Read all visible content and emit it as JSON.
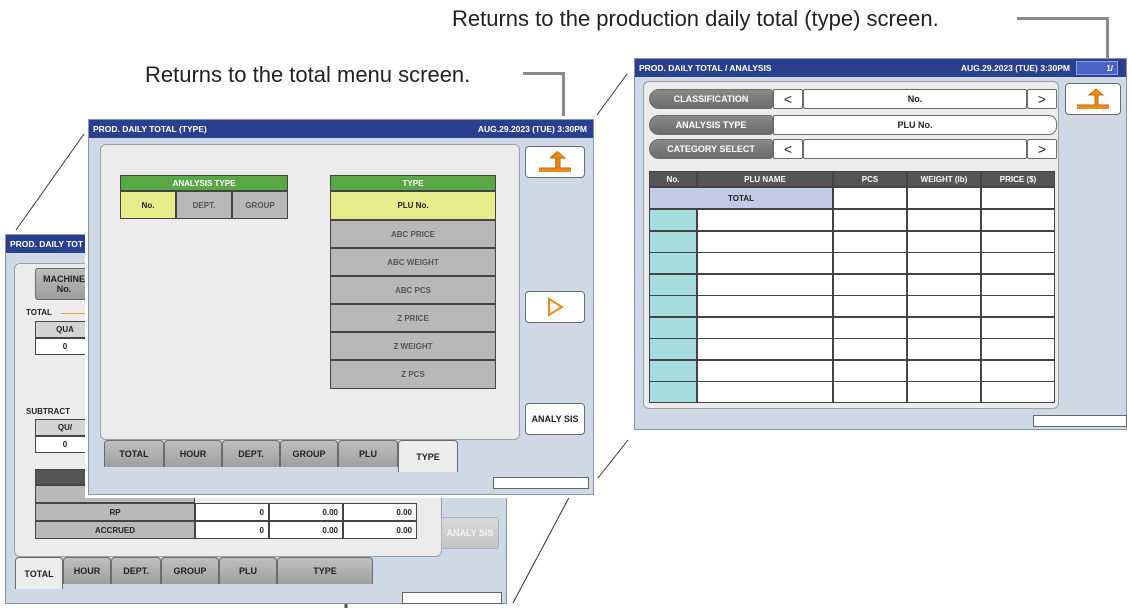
{
  "callouts": {
    "production_type_return": "Returns to the production daily total (type) screen.",
    "total_menu_return": "Returns to the total menu screen."
  },
  "back_screen": {
    "title": "PROD. DAILY TOT",
    "machine_label": "MACHINE No.",
    "total_label": "TOTAL",
    "qty_header": "QUA",
    "qty_value": "0",
    "subtract_label": "SUBTRACT",
    "sub_qty_header": "QU/",
    "sub_qty_value": "0",
    "rows": [
      {
        "label": "RP",
        "qty": "0",
        "weight": "0.00",
        "price": "0.00"
      },
      {
        "label": "ACCRUED",
        "qty": "0",
        "weight": "0.00",
        "price": "0.00"
      }
    ],
    "analysis_label": "ANALY SIS",
    "tabs": [
      "TOTAL",
      "HOUR",
      "DEPT.",
      "GROUP",
      "PLU",
      "TYPE"
    ]
  },
  "middle_screen": {
    "title": "PROD. DAILY TOTAL (TYPE)",
    "datetime": "AUG.29.2023 (TUE) 3:30PM",
    "analysis_type_header": "ANALYSIS TYPE",
    "analysis_options": [
      "No.",
      "DEPT.",
      "GROUP"
    ],
    "type_header": "TYPE",
    "type_options": [
      "PLU No.",
      "ABC PRICE",
      "ABC WEIGHT",
      "ABC PCS",
      "Z PRICE",
      "Z WEIGHT",
      "Z PCS"
    ],
    "analysis_button": "ANALY SIS",
    "tabs": [
      "TOTAL",
      "HOUR",
      "DEPT.",
      "GROUP",
      "PLU",
      "TYPE"
    ]
  },
  "right_screen": {
    "title": "PROD. DAILY TOTAL / ANALYSIS",
    "datetime": "AUG.29.2023 (TUE)  3:30PM",
    "page": "1/",
    "classification_label": "CLASSIFICATION",
    "classification_value": "No.",
    "analysis_type_label": "ANALYSIS TYPE",
    "analysis_type_value": "PLU No.",
    "category_label": "CATEGORY SELECT",
    "category_value": "",
    "table_headers": [
      "No.",
      "PLU NAME",
      "PCS",
      "WEIGHT (lb)",
      "PRICE ($)"
    ],
    "total_label": "TOTAL"
  },
  "colors": {
    "titlebar": "#2b3f8f",
    "selected_yellow": "#e9ec8a",
    "header_green": "#5aa845",
    "header_dark": "#555555",
    "teal": "#a8dde0",
    "total_blue": "#c3cbe6"
  },
  "icons": {
    "return": "return-arrow-icon",
    "next": "play-right-icon",
    "prev": "chevron-left-icon",
    "forward": "chevron-right-icon"
  }
}
